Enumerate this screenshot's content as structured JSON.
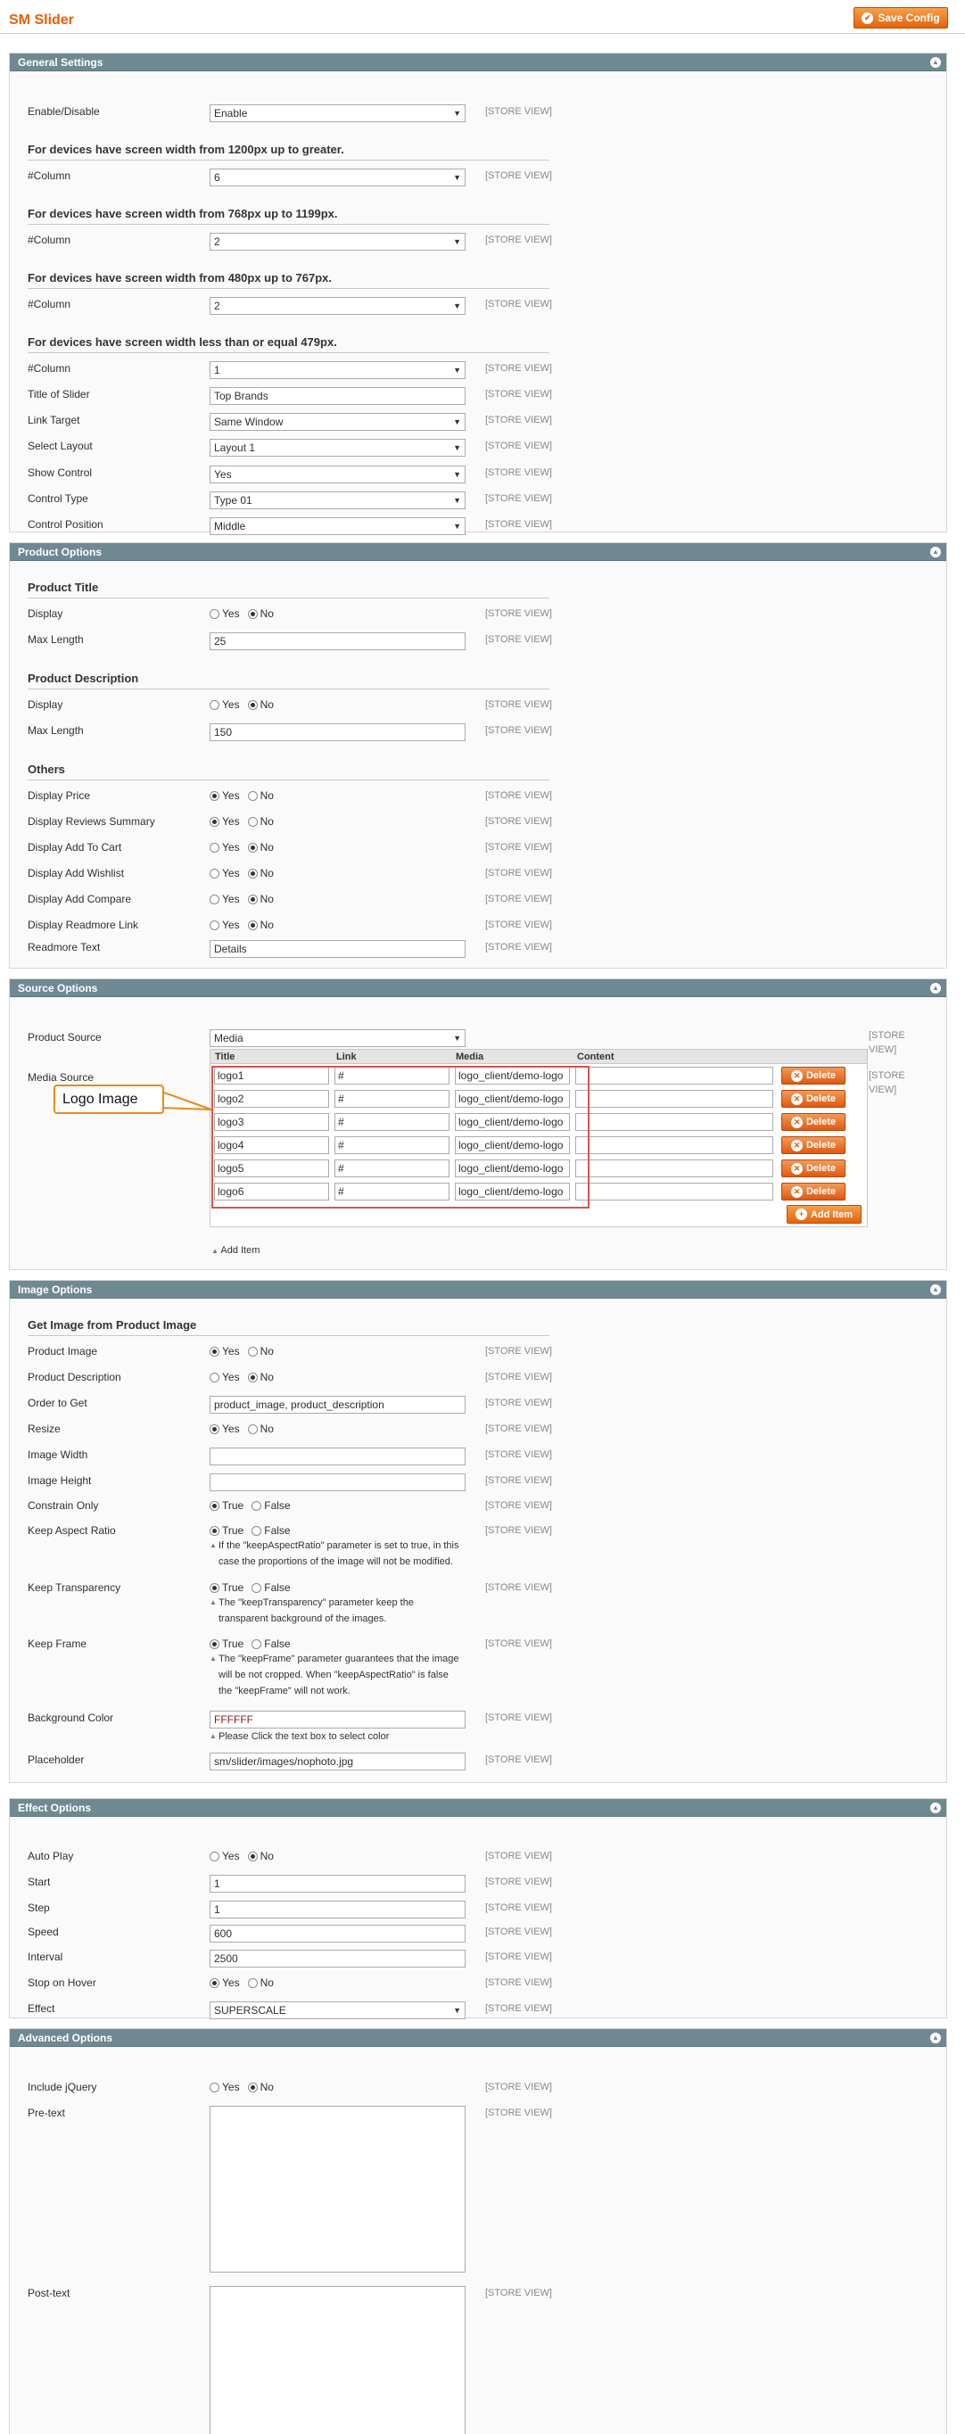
{
  "page": {
    "title": "SM Slider",
    "save_label": "Save Config",
    "scope": "[STORE VIEW]"
  },
  "general": {
    "title": "General Settings",
    "enable": {
      "label": "Enable/Disable",
      "value": "Enable"
    },
    "h1200": "For devices have screen width from 1200px up to greater.",
    "col1200": {
      "label": "#Column",
      "value": "6"
    },
    "h768": "For devices have screen width from 768px up to 1199px.",
    "col768": {
      "label": "#Column",
      "value": "2"
    },
    "h480": "For devices have screen width from 480px up to 767px.",
    "col480": {
      "label": "#Column",
      "value": "2"
    },
    "h479": "For devices have screen width less than or equal 479px.",
    "col479": {
      "label": "#Column",
      "value": "1"
    },
    "title_slider": {
      "label": "Title of Slider",
      "value": "Top Brands"
    },
    "link_target": {
      "label": "Link Target",
      "value": "Same Window"
    },
    "layout": {
      "label": "Select Layout",
      "value": "Layout 1"
    },
    "show_control": {
      "label": "Show Control",
      "value": "Yes"
    },
    "control_type": {
      "label": "Control Type",
      "value": "Type 01"
    },
    "control_position": {
      "label": "Control Position",
      "value": "Middle"
    }
  },
  "product": {
    "title": "Product Options",
    "h_title": "Product Title",
    "t_display": {
      "label": "Display",
      "selected": "No"
    },
    "t_maxlen": {
      "label": "Max Length",
      "value": "25"
    },
    "h_desc": "Product Description",
    "d_display": {
      "label": "Display",
      "selected": "No"
    },
    "d_maxlen": {
      "label": "Max Length",
      "value": "150"
    },
    "h_others": "Others",
    "price": {
      "label": "Display Price",
      "selected": "Yes"
    },
    "reviews": {
      "label": "Display Reviews Summary",
      "selected": "Yes"
    },
    "cart": {
      "label": "Display Add To Cart",
      "selected": "No"
    },
    "wishlist": {
      "label": "Display Add Wishlist",
      "selected": "No"
    },
    "compare": {
      "label": "Display Add Compare",
      "selected": "No"
    },
    "readmore": {
      "label": "Display Readmore Link",
      "selected": "No"
    },
    "readmore_text": {
      "label": "Readmore Text",
      "value": "Details"
    }
  },
  "source": {
    "title": "Source Options",
    "product_source": {
      "label": "Product Source",
      "value": "Media"
    },
    "media_label": "Media Source",
    "scope1": "[STORE",
    "scope2": "VIEW]",
    "cols": [
      "Title",
      "Link",
      "Media",
      "Content"
    ],
    "rows": [
      {
        "title": "logo1",
        "link": "#",
        "media": "logo_client/demo-logo"
      },
      {
        "title": "logo2",
        "link": "#",
        "media": "logo_client/demo-logo"
      },
      {
        "title": "logo3",
        "link": "#",
        "media": "logo_client/demo-logo"
      },
      {
        "title": "logo4",
        "link": "#",
        "media": "logo_client/demo-logo"
      },
      {
        "title": "logo5",
        "link": "#",
        "media": "logo_client/demo-logo"
      },
      {
        "title": "logo6",
        "link": "#",
        "media": "logo_client/demo-logo"
      }
    ],
    "delete_label": "Delete",
    "add_item_btn": "Add Item",
    "add_item_link": "Add Item",
    "callout": "Logo Image"
  },
  "image": {
    "title": "Image Options",
    "h_get": "Get Image from Product Image",
    "prod_image": {
      "label": "Product Image",
      "selected": "Yes"
    },
    "prod_desc": {
      "label": "Product Description",
      "selected": "No"
    },
    "order": {
      "label": "Order to Get",
      "value": "product_image, product_description"
    },
    "resize": {
      "label": "Resize",
      "selected": "Yes"
    },
    "width": {
      "label": "Image Width",
      "value": ""
    },
    "height": {
      "label": "Image Height",
      "value": ""
    },
    "constrain": {
      "label": "Constrain Only",
      "selected": "True"
    },
    "aspect": {
      "label": "Keep Aspect Ratio",
      "selected": "True",
      "note1": "If the \"keepAspectRatio\" parameter is set to true, in this",
      "note2": "case the proportions of the image will not be modified."
    },
    "transparency": {
      "label": "Keep Transparency",
      "selected": "True",
      "note1": "The \"keepTransparency\" parameter keep the",
      "note2": "transparent background of the images."
    },
    "frame": {
      "label": "Keep Frame",
      "selected": "True",
      "note1": "The \"keepFrame\" parameter guarantees that the image",
      "note2": "will be not cropped. When \"keepAspectRatio\" is false",
      "note3": "the \"keepFrame\" will not work."
    },
    "bg": {
      "label": "Background Color",
      "value": "FFFFFF",
      "note": "Please Click the text box to select color"
    },
    "placeholder": {
      "label": "Placeholder",
      "value": "sm/slider/images/nophoto.jpg"
    }
  },
  "effect": {
    "title": "Effect Options",
    "autoplay": {
      "label": "Auto Play",
      "selected": "No"
    },
    "start": {
      "label": "Start",
      "value": "1"
    },
    "step": {
      "label": "Step",
      "value": "1"
    },
    "speed": {
      "label": "Speed",
      "value": "600"
    },
    "interval": {
      "label": "Interval",
      "value": "2500"
    },
    "hover": {
      "label": "Stop on Hover",
      "selected": "Yes"
    },
    "effect": {
      "label": "Effect",
      "value": "SUPERSCALE"
    }
  },
  "advanced": {
    "title": "Advanced Options",
    "jquery": {
      "label": "Include jQuery",
      "selected": "No"
    },
    "pretext": {
      "label": "Pre-text"
    },
    "posttext": {
      "label": "Post-text"
    }
  },
  "opt": {
    "yes": "Yes",
    "no": "No",
    "true": "True",
    "false": "False"
  },
  "colors": {
    "header": "#6f8992",
    "accent": "#eb5e00",
    "button": "#e3630b",
    "callout": "#e68a1c",
    "highlight": "#d9534f"
  }
}
